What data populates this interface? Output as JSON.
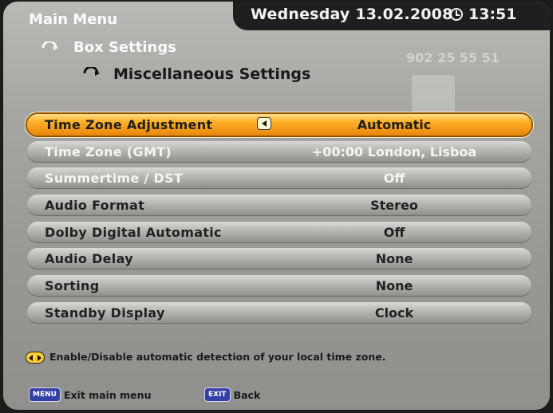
{
  "header": {
    "date": "Wednesday 13.02.2008",
    "time": "13:51",
    "phone": "902 25 55 51"
  },
  "breadcrumb": {
    "main": "Main Menu",
    "box": "Box Settings",
    "misc": "Miscellaneous Settings"
  },
  "menu": {
    "items": [
      {
        "label": "Time Zone Adjustment",
        "value": "Automatic",
        "state": "active"
      },
      {
        "label": "Time Zone (GMT)",
        "value": "+00:00  London, Lisboa",
        "state": "disabled"
      },
      {
        "label": "Summertime / DST",
        "value": "Off",
        "state": "disabled"
      },
      {
        "label": "Audio Format",
        "value": "Stereo",
        "state": "normal"
      },
      {
        "label": "Dolby Digital Automatic",
        "value": "Off",
        "state": "normal"
      },
      {
        "label": "Audio Delay",
        "value": "None",
        "state": "normal"
      },
      {
        "label": "Sorting",
        "value": "None",
        "state": "normal"
      },
      {
        "label": "Standby Display",
        "value": "Clock",
        "state": "normal"
      }
    ]
  },
  "hint": "Enable/Disable automatic detection of your local time zone.",
  "footer": {
    "menu_key": "MENU",
    "menu_label": "Exit main menu",
    "exit_key": "EXIT",
    "exit_label": "Back"
  },
  "colors": {
    "highlight": "#ffb02a",
    "panel": "#a7a7a4",
    "key_blue": "#3340a8"
  }
}
